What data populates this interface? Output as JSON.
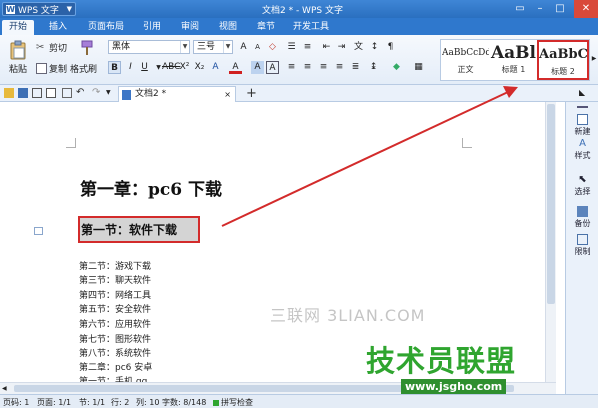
{
  "app": {
    "menu_button_label": "WPS 文字",
    "window_title": "文档2 * - WPS 文字"
  },
  "tabs": [
    "开始",
    "插入",
    "页面布局",
    "引用",
    "审阅",
    "视图",
    "章节",
    "开发工具"
  ],
  "ribbon": {
    "paste": "粘贴",
    "cut": "剪切",
    "copy": "复制",
    "format_painter": "格式刷",
    "font_name": "黑体",
    "font_size": "三号",
    "styles": [
      {
        "preview": "AaBbCcDd",
        "name": "正文"
      },
      {
        "preview": "AaBl",
        "name": "标题 1"
      },
      {
        "preview": "AaBbC",
        "name": "标题 2"
      }
    ]
  },
  "document_tab": {
    "title": "文档2 *",
    "add_label": "+"
  },
  "document": {
    "heading1": "第一章：pc6 下载",
    "heading2": "第一节：软件下载",
    "lines": [
      "第二节：游戏下载",
      "第三节：聊天软件",
      "第四节：网络工具",
      "第五节：安全软件",
      "第六节：应用软件",
      "第七节：图形软件",
      "第八节：系统软件",
      "第二章：pc6 安卓",
      "第一节：手机 qq"
    ]
  },
  "task_pane": [
    "新建",
    "样式",
    "选择",
    "备份",
    "限制"
  ],
  "statusbar": {
    "page": "页码: 1",
    "pages": "页面: 1/1",
    "section": "节: 1/1",
    "row": "行: 2",
    "col": "列: 10",
    "word_count": "字数: 8/148",
    "spell_check": "拼写检查"
  },
  "watermarks": {
    "site_cn": "三联网 3LIAN.COM",
    "brand": "技术员联盟",
    "url": "www.jsgho.com"
  },
  "colors": {
    "titlebar": "#2a6fbf",
    "highlight": "#d32b2b",
    "watermark_green": "#2fa52f"
  }
}
